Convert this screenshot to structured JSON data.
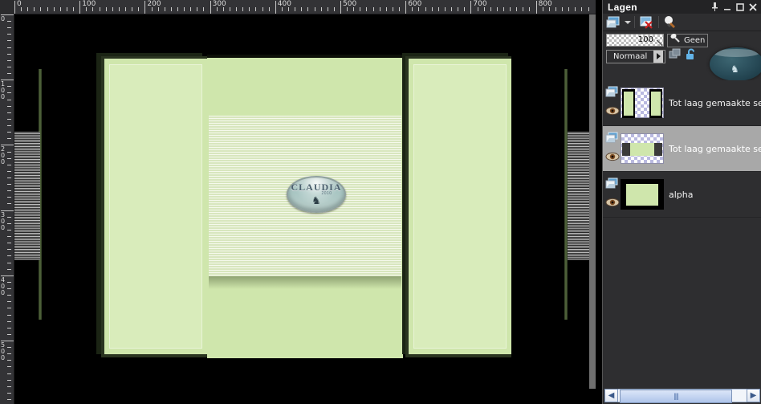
{
  "window": {
    "palette_title": "Lagen",
    "buttons": [
      {
        "name": "pin-button",
        "glyph": "⚓",
        "label": "Pin"
      },
      {
        "name": "minimize-button",
        "glyph": "–",
        "label": "Minimaliseren"
      },
      {
        "name": "maximize-button",
        "glyph": "□",
        "label": "Maximaliseren"
      },
      {
        "name": "close-button",
        "glyph": "✕",
        "label": "Sluiten"
      }
    ]
  },
  "toolbar": {
    "new_layer_label": "Nieuwe laag",
    "delete_layer_label": "Laag verwijderen",
    "mask_label": "Masker"
  },
  "properties": {
    "opacity_value": "100",
    "mask_value": "Geen",
    "blend_mode": "Normaal",
    "lock_state": "unlocked"
  },
  "layers": [
    {
      "name": "Tot laag gemaakte select",
      "selected": false,
      "visible": true,
      "thumb": "two-green-panels"
    },
    {
      "name": "Tot laag gemaakte select",
      "selected": true,
      "visible": true,
      "thumb": "center-green-band"
    },
    {
      "name": "alpha",
      "selected": false,
      "visible": true,
      "thumb": "solid-green-on-black"
    }
  ],
  "rulers": {
    "horizontal_labels": [
      "0",
      "100",
      "200",
      "300",
      "400",
      "500",
      "600",
      "700",
      "800"
    ],
    "vertical_labels": [
      "0",
      "100",
      "200",
      "300",
      "400",
      "500"
    ],
    "unit": "pixels"
  },
  "artwork": {
    "background_color": "#000000",
    "panel_color": "#cfe6ac",
    "panel_border_color": "#3d4a2c",
    "logo": {
      "text": "CLAUDIA",
      "subtext": "2010",
      "mark": "♞"
    }
  },
  "scrollbar": {
    "left_arrow": "◀",
    "right_arrow": "▶",
    "grip": "||||"
  }
}
